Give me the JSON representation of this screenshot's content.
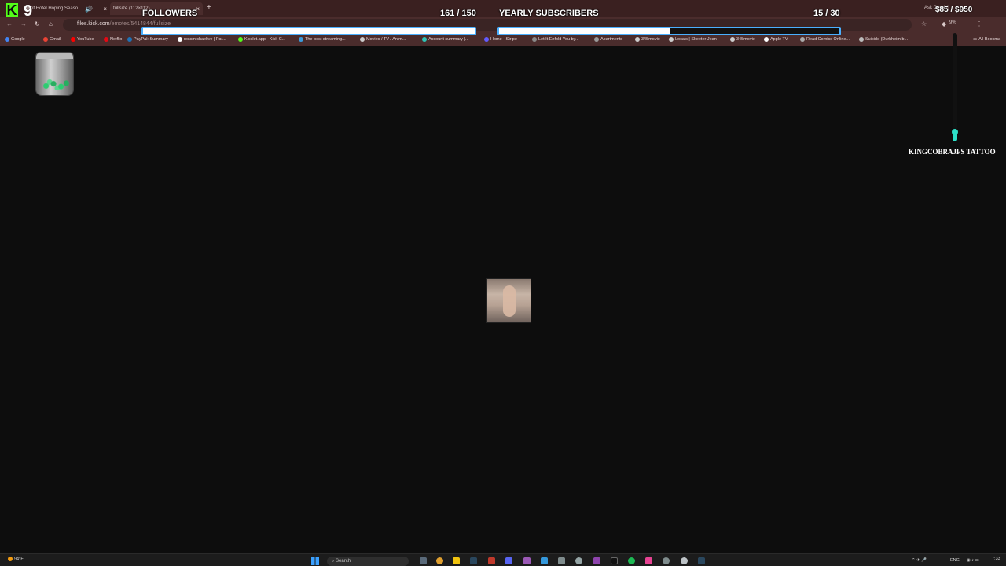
{
  "browser": {
    "tabs": [
      {
        "label": "d of Hotel Hoping Seaso"
      },
      {
        "label": "fullsize (112×112)"
      }
    ],
    "new_tab_icon": "plus-icon",
    "url": {
      "host": "files.kick.com",
      "path": "/emotes/5414844/fullsize"
    },
    "bookmarks": [
      {
        "label": "Google",
        "color": "#4285f4"
      },
      {
        "label": "Gmail",
        "color": "#ea4335"
      },
      {
        "label": "YouTube",
        "color": "#ff0000"
      },
      {
        "label": "Netflix",
        "color": "#e50914"
      },
      {
        "label": "PayPal: Summary",
        "color": "#1f73b7"
      },
      {
        "label": "rossmichaelive | Pat...",
        "color": "#ffffff"
      },
      {
        "label": "Kicklet.app - Kick C...",
        "color": "#53fc18"
      },
      {
        "label": "The best streaming...",
        "color": "#3a9bdc"
      },
      {
        "label": "Movies / TV / Anim...",
        "color": "#cccccc"
      },
      {
        "label": "Account summary |...",
        "color": "#2ec4b6"
      },
      {
        "label": "Home - Stripe",
        "color": "#635bff"
      },
      {
        "label": "Let It Enfold You by...",
        "color": "#888888"
      },
      {
        "label": "Apartments",
        "color": "#999999"
      },
      {
        "label": "345movie",
        "color": "#cccccc"
      },
      {
        "label": "Locals | Skeeter Jean",
        "color": "#cccccc"
      },
      {
        "label": "345movie",
        "color": "#cccccc"
      },
      {
        "label": "Apple TV",
        "color": "#ffffff"
      },
      {
        "label": "Read Comics Online...",
        "color": "#aaaaaa"
      },
      {
        "label": "Suicide (Durkheim b...",
        "color": "#bbbbbb"
      }
    ],
    "all_bookmarks": "All Bookma",
    "ask_label": "Ask Gemini",
    "extension_percent": "9%"
  },
  "overlay": {
    "logo_letter": "K",
    "logo_number": "9",
    "followers": {
      "label": "FOLLOWERS",
      "count": "161 / 150",
      "fill_fraction": 1.0
    },
    "subscribers": {
      "label": "YEARLY SUBSCRIBERS",
      "count": "15 / 30",
      "fill_fraction": 0.5
    },
    "money": "$85 / $950",
    "money_fill_fraction": 0.09,
    "sponsor": "KINGCOBRAJFS TATTOO"
  },
  "taskbar": {
    "weather": "94°F",
    "search_placeholder": "Search",
    "lang": "ENG",
    "time": "7:33"
  },
  "colors": {
    "kick_green": "#53fc18",
    "goal_border": "#4ab0ff",
    "meter_teal": "#2de0c8"
  }
}
